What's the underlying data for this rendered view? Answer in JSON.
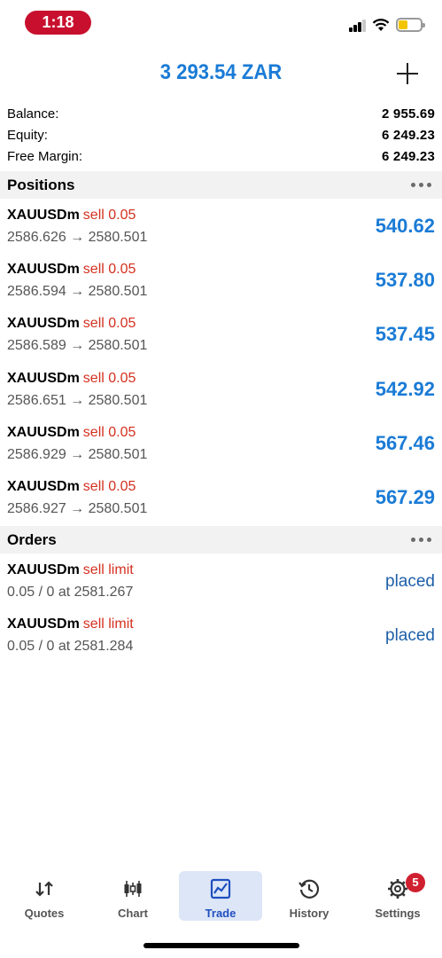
{
  "status_bar": {
    "time": "1:18"
  },
  "header": {
    "title": "3 293.54 ZAR"
  },
  "summary": [
    {
      "label": "Balance:",
      "value": "2 955.69"
    },
    {
      "label": "Equity:",
      "value": "6 249.23"
    },
    {
      "label": "Free Margin:",
      "value": "6 249.23"
    }
  ],
  "positions": {
    "title": "Positions",
    "items": [
      {
        "symbol": "XAUUSDm",
        "side": "sell 0.05",
        "prices": "2586.626 → 2580.501",
        "profit": "540.62"
      },
      {
        "symbol": "XAUUSDm",
        "side": "sell 0.05",
        "prices": "2586.594 → 2580.501",
        "profit": "537.80"
      },
      {
        "symbol": "XAUUSDm",
        "side": "sell 0.05",
        "prices": "2586.589 → 2580.501",
        "profit": "537.45"
      },
      {
        "symbol": "XAUUSDm",
        "side": "sell 0.05",
        "prices": "2586.651 → 2580.501",
        "profit": "542.92"
      },
      {
        "symbol": "XAUUSDm",
        "side": "sell 0.05",
        "prices": "2586.929 → 2580.501",
        "profit": "567.46"
      },
      {
        "symbol": "XAUUSDm",
        "side": "sell 0.05",
        "prices": "2586.927 → 2580.501",
        "profit": "567.29"
      }
    ]
  },
  "orders": {
    "title": "Orders",
    "items": [
      {
        "symbol": "XAUUSDm",
        "side": "sell limit",
        "details": "0.05 / 0 at 2581.267",
        "state": "placed"
      },
      {
        "symbol": "XAUUSDm",
        "side": "sell limit",
        "details": "0.05 / 0 at 2581.284",
        "state": "placed"
      }
    ]
  },
  "tabs": [
    {
      "label": "Quotes",
      "icon": "quotes-arrows-icon"
    },
    {
      "label": "Chart",
      "icon": "candlestick-icon"
    },
    {
      "label": "Trade",
      "icon": "trade-chart-icon",
      "active": true
    },
    {
      "label": "History",
      "icon": "history-clock-icon"
    },
    {
      "label": "Settings",
      "icon": "gear-icon",
      "badge": "5"
    }
  ],
  "colors": {
    "accent": "#1a7bd6",
    "sell": "#d4301f",
    "active_tab_bg": "#dde6f7",
    "badge": "#d0202f"
  }
}
